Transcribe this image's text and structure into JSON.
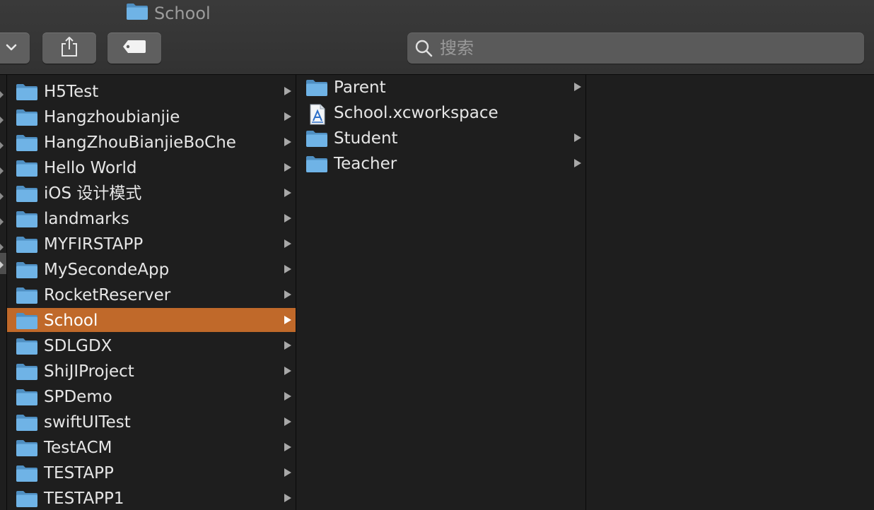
{
  "window": {
    "title": "School"
  },
  "toolbar": {
    "dropdown_icon": "chevron-down-icon",
    "share_icon": "share-icon",
    "tag_icon": "tag-icon"
  },
  "search": {
    "placeholder": "搜索",
    "value": ""
  },
  "colors": {
    "selection": "#c0692a",
    "folder": "#5fa6dd",
    "background": "#1e1e1e",
    "toolbar": "#363636"
  },
  "column1": {
    "items": [
      {
        "label": "H5Test",
        "type": "folder"
      },
      {
        "label": "Hangzhoubianjie",
        "type": "folder"
      },
      {
        "label": "HangZhouBianjieBoChe",
        "type": "folder"
      },
      {
        "label": "Hello World",
        "type": "folder"
      },
      {
        "label": "iOS 设计模式",
        "type": "folder"
      },
      {
        "label": "landmarks",
        "type": "folder"
      },
      {
        "label": "MYFIRSTAPP",
        "type": "folder"
      },
      {
        "label": "MySecondeApp",
        "type": "folder"
      },
      {
        "label": "RocketReserver",
        "type": "folder"
      },
      {
        "label": "School",
        "type": "folder",
        "selected": true
      },
      {
        "label": "SDLGDX",
        "type": "folder"
      },
      {
        "label": "ShiJIProject",
        "type": "folder"
      },
      {
        "label": "SPDemo",
        "type": "folder"
      },
      {
        "label": "swiftUITest",
        "type": "folder"
      },
      {
        "label": "TestACM",
        "type": "folder"
      },
      {
        "label": "TESTAPP",
        "type": "folder"
      },
      {
        "label": "TESTAPP1",
        "type": "folder"
      }
    ]
  },
  "column2": {
    "items": [
      {
        "label": "Parent",
        "type": "folder"
      },
      {
        "label": "School.xcworkspace",
        "type": "xcworkspace-file"
      },
      {
        "label": "Student",
        "type": "folder"
      },
      {
        "label": "Teacher",
        "type": "folder"
      }
    ]
  }
}
